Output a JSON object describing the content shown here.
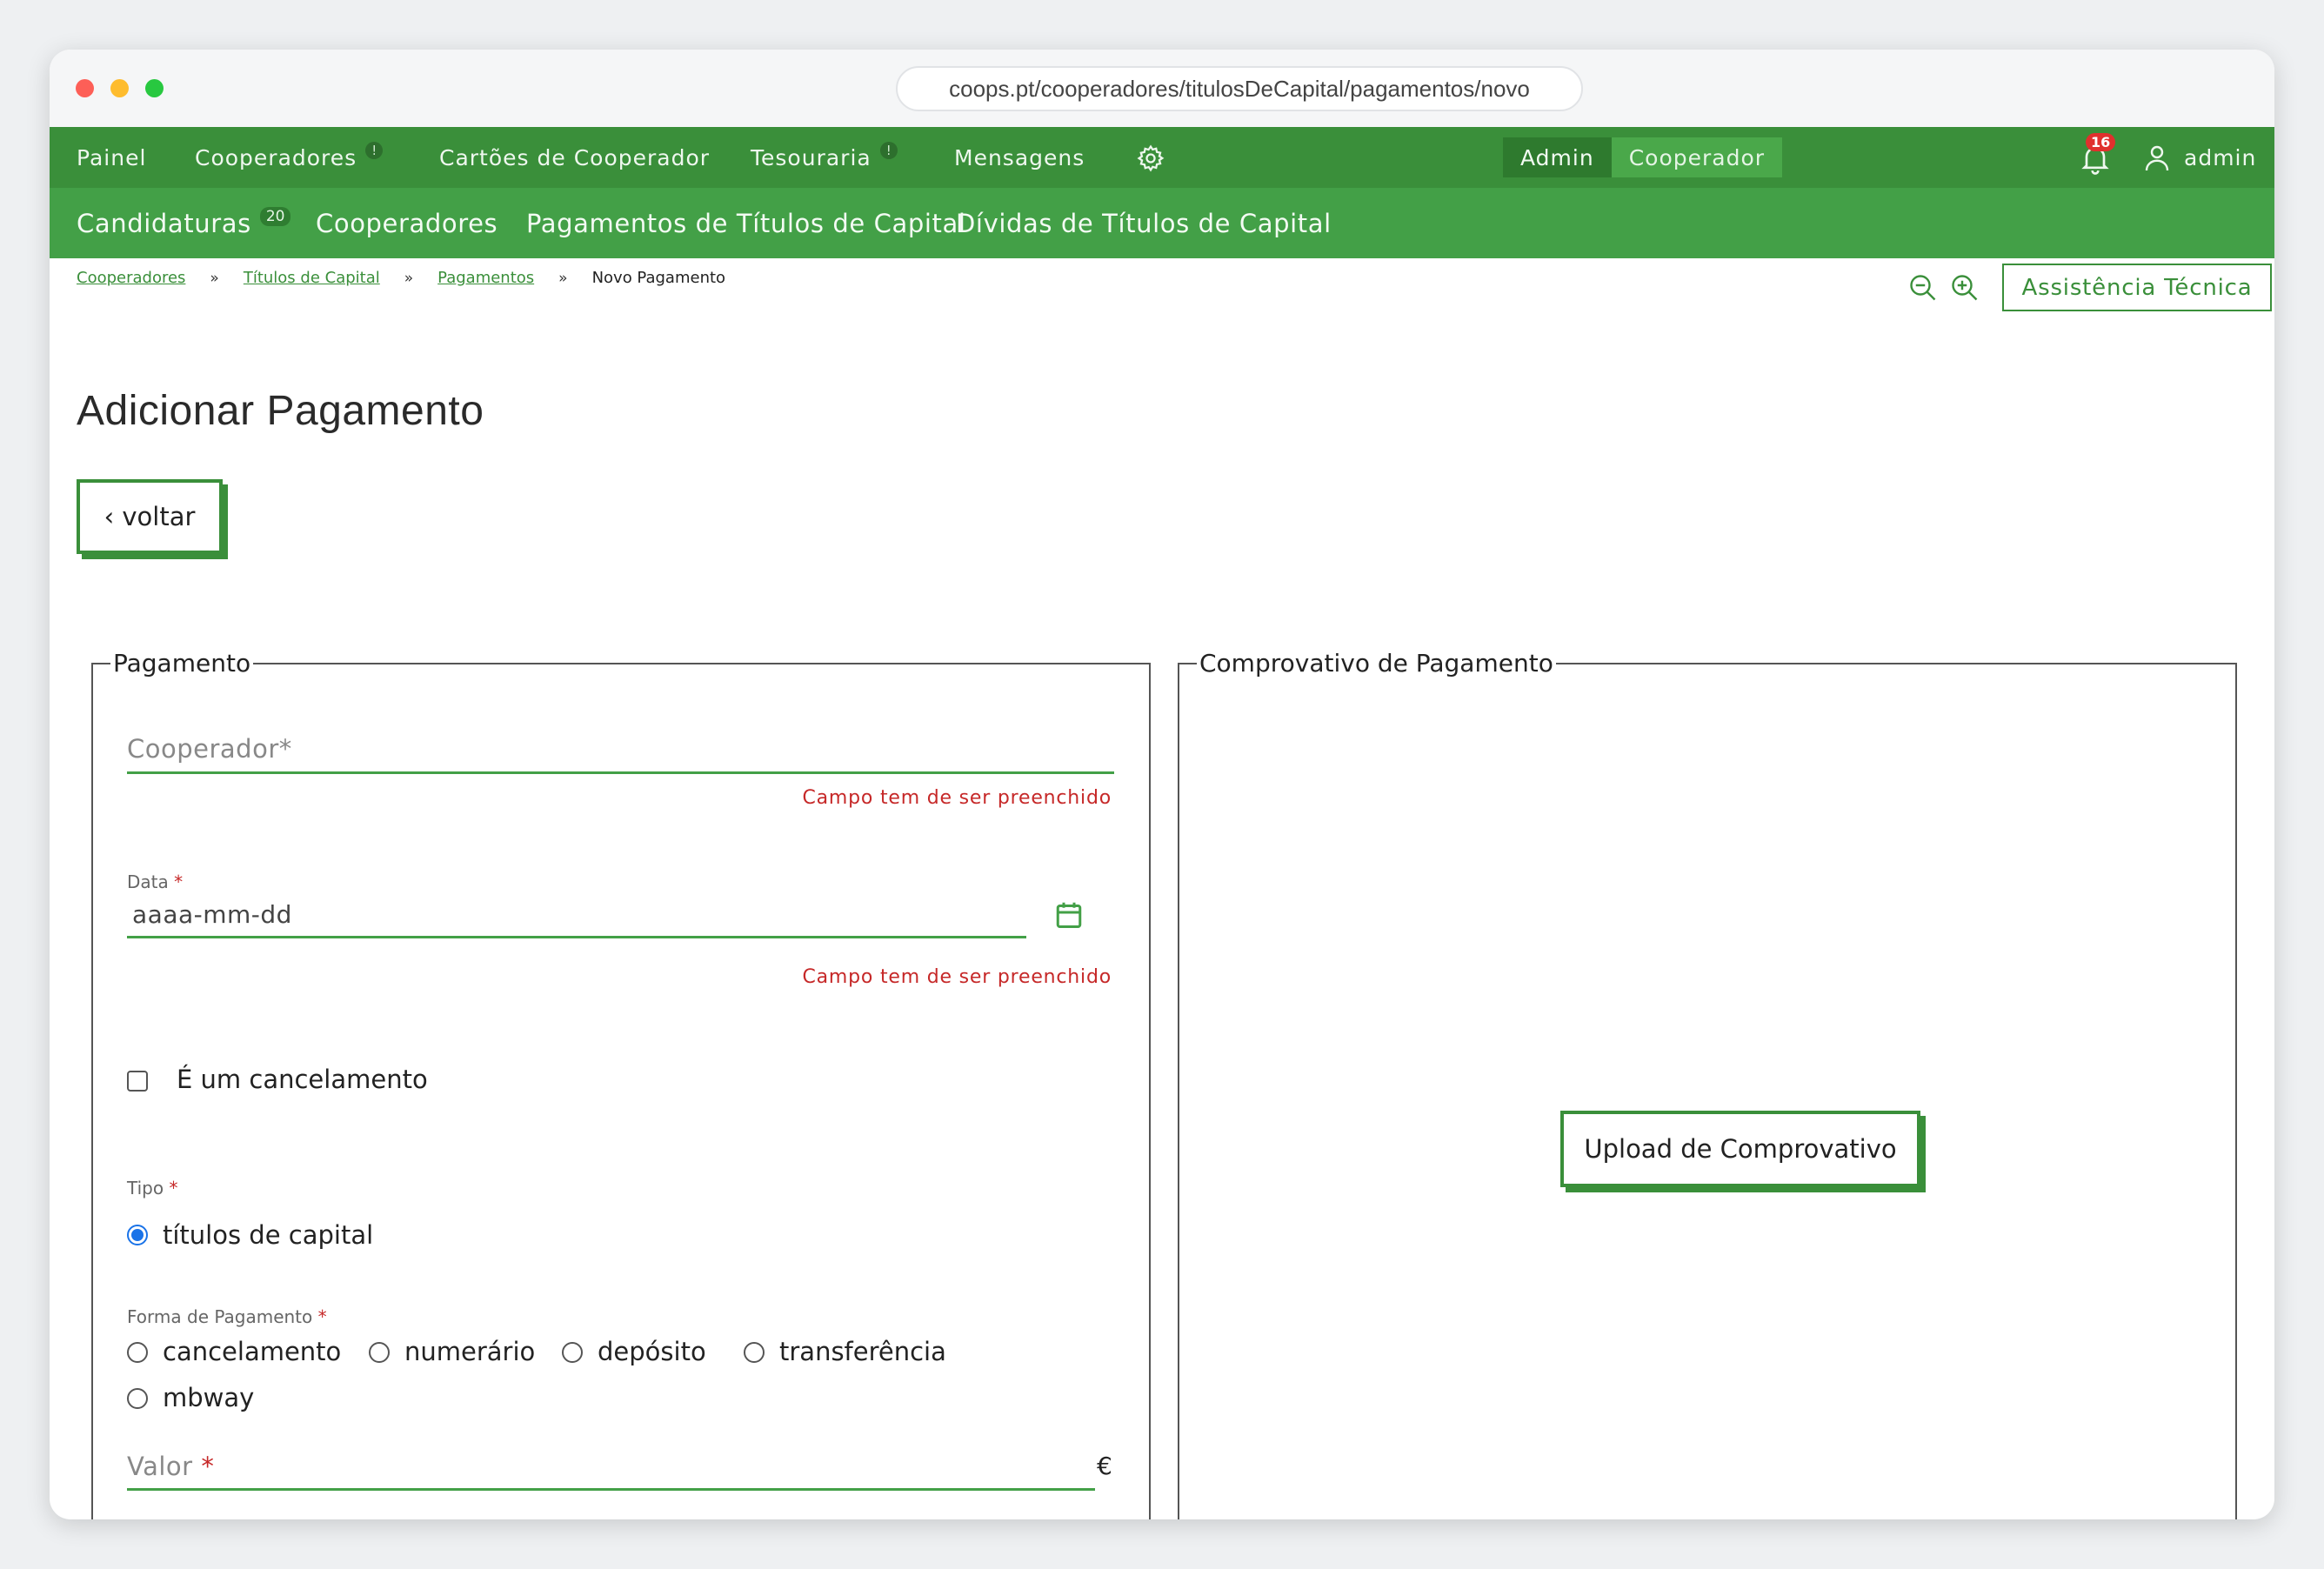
{
  "browser": {
    "url": "coops.pt/cooperadores/titulosDeCapital/pagamentos/novo"
  },
  "nav": {
    "items": [
      {
        "label": "Painel",
        "badge": ""
      },
      {
        "label": "Cooperadores",
        "badge": "!"
      },
      {
        "label": "Cartões de Cooperador",
        "badge": ""
      },
      {
        "label": "Tesouraria",
        "badge": "!"
      },
      {
        "label": "Mensagens",
        "badge": ""
      }
    ],
    "settings_icon": "gear-icon",
    "roles": [
      "Admin",
      "Cooperador"
    ],
    "notifications_count": "16",
    "user": "admin"
  },
  "subnav": {
    "items": [
      {
        "label": "Candidaturas",
        "badge": "20"
      },
      {
        "label": "Cooperadores",
        "badge": ""
      },
      {
        "label": "Pagamentos de Títulos de Capital",
        "badge": ""
      },
      {
        "label": "Dívidas de Títulos de Capital",
        "badge": ""
      }
    ]
  },
  "breadcrumb": {
    "items": [
      "Cooperadores",
      "Títulos de Capital",
      "Pagamentos"
    ],
    "separator": "»",
    "current": "Novo Pagamento"
  },
  "toolbar": {
    "assist_label": "Assistência Técnica"
  },
  "page": {
    "title": "Adicionar Pagamento",
    "back_label": "‹ voltar"
  },
  "payment": {
    "legend": "Pagamento",
    "cooperador_label": "Cooperador*",
    "required_error": "Campo tem de ser preenchido",
    "date_label": "Data",
    "date_placeholder": "aaaa-mm-dd",
    "cancel_checkbox_label": "É um cancelamento",
    "cancel_checked": false,
    "type_label": "Tipo",
    "type_options": [
      "títulos de capital"
    ],
    "type_selected": "títulos de capital",
    "method_label": "Forma de Pagamento",
    "method_options": [
      "cancelamento",
      "numerário",
      "depósito",
      "transferência",
      "mbway"
    ],
    "method_selected": "",
    "value_label": "Valor",
    "currency": "€",
    "required_mark": "*"
  },
  "proof": {
    "legend": "Comprovativo de Pagamento",
    "upload_label": "Upload de Comprovativo"
  },
  "colors": {
    "nav_green": "#3a8f3a",
    "subnav_green": "#43a047",
    "error_red": "#c62828",
    "radio_blue": "#1a73e8",
    "badge_red": "#e0302d"
  }
}
